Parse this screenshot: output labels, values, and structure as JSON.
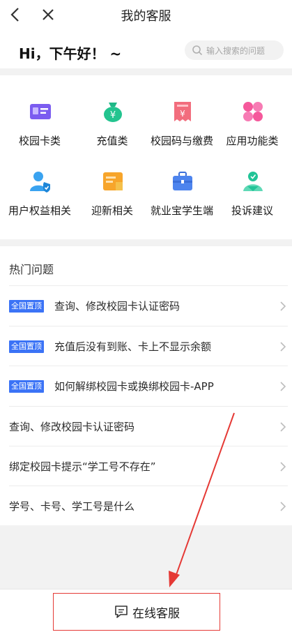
{
  "header": {
    "title": "我的客服"
  },
  "greeting": {
    "text": "Hi，下午好！ ~"
  },
  "search": {
    "placeholder": "输入搜索的问题"
  },
  "categories": [
    {
      "label": "校园卡类",
      "icon": "id-card-icon"
    },
    {
      "label": "充值类",
      "icon": "money-bag-icon"
    },
    {
      "label": "校园码与缴费",
      "icon": "yuan-receipt-icon"
    },
    {
      "label": "应用功能类",
      "icon": "app-grid-icon"
    },
    {
      "label": "用户权益相关",
      "icon": "user-shield-icon"
    },
    {
      "label": "迎新相关",
      "icon": "welcome-card-icon"
    },
    {
      "label": "就业宝学生端",
      "icon": "briefcase-icon"
    },
    {
      "label": "投诉建议",
      "icon": "feedback-person-icon"
    }
  ],
  "hot": {
    "title": "热门问题",
    "badge_label": "全国置顶",
    "questions": [
      {
        "text": "查询、修改校园卡认证密码",
        "pinned": true
      },
      {
        "text": "充值后没有到账、卡上不显示余额",
        "pinned": true
      },
      {
        "text": "如何解绑校园卡或换绑校园卡-APP",
        "pinned": true
      },
      {
        "text": "查询、修改校园卡认证密码",
        "pinned": false
      },
      {
        "text": "绑定校园卡提示“学工号不存在”",
        "pinned": false
      },
      {
        "text": "学号、卡号、学工号是什么",
        "pinned": false
      }
    ]
  },
  "bottom": {
    "online_service_label": "在线客服"
  },
  "colors": {
    "accent_blue": "#3b73f6",
    "highlight_red": "#e53935"
  }
}
